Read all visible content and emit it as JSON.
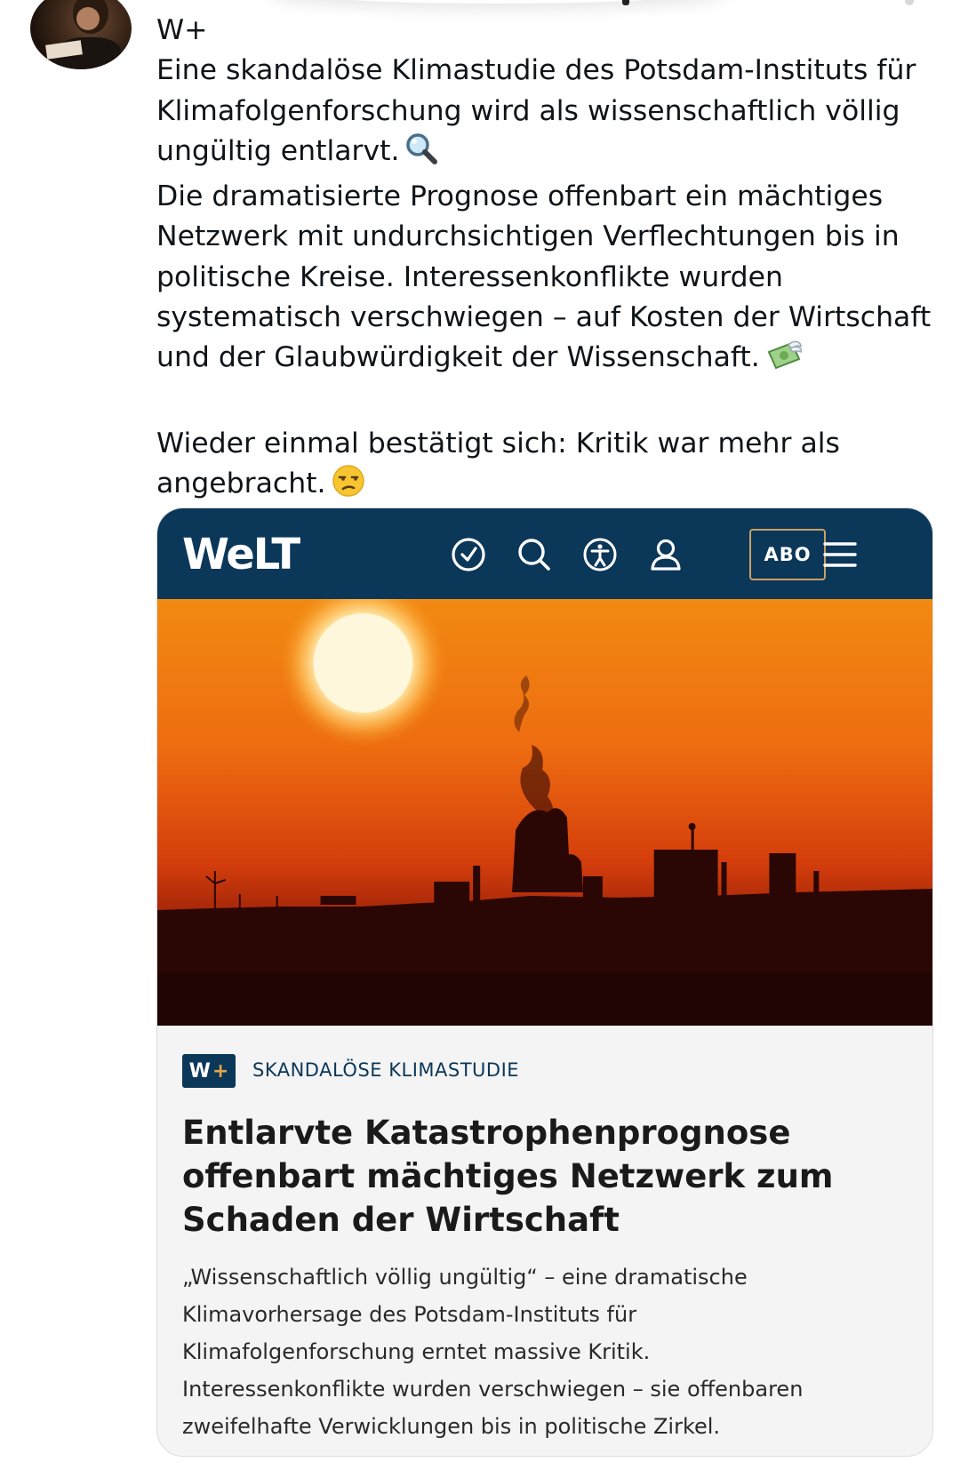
{
  "post": {
    "lines": [
      "W+",
      "Eine skandalöse Klimastudie des Potsdam-Instituts für",
      "Klimafolgenforschung wird als wissenschaftlich völlig",
      "ungültig entlarvt.",
      "Die dramatisierte Prognose offenbart ein mächtiges",
      "Netzwerk mit undurchsichtigen Verflechtungen bis in",
      "politische Kreise. Interessenkonflikte wurden",
      "systematisch verschwiegen – auf Kosten der Wirtschaft",
      "und der Glaubwürdigkeit der Wissenschaft.",
      "Wieder einmal bestätigt sich: Kritik war mehr als",
      "angebracht."
    ],
    "emoji_icons": [
      "magnifying-glass-icon",
      "money-with-wings-icon",
      "unamused-face-icon"
    ]
  },
  "card": {
    "brand": "WeLT",
    "header_icons": [
      "clock-icon",
      "search-icon",
      "accessibility-icon",
      "user-icon",
      "menu-icon"
    ],
    "abo_label": "ABO",
    "badge": {
      "w": "W",
      "plus": "+"
    },
    "kicker": "SKANDALÖSE KLIMASTUDIE",
    "headline_lines": [
      "Entlarvte Katastrophenprognose",
      "offenbart mächtiges Netzwerk zum",
      "Schaden der Wirtschaft"
    ],
    "teaser_lines": [
      "„Wissenschaftlich völlig ungültig“ – eine dramatische",
      "Klimavorhersage des Potsdam-Instituts für",
      "Klimafolgenforschung erntet massive Kritik.",
      "Interessenkonflikte wurden verschwiegen – sie offenbaren",
      "zweifelhafte Verwicklungen bis in politische Zirkel."
    ]
  },
  "colors": {
    "header_bg": "#0b3759",
    "abo_border": "#c8a063",
    "kicker": "#0b3759",
    "plus": "#e2a64a"
  }
}
